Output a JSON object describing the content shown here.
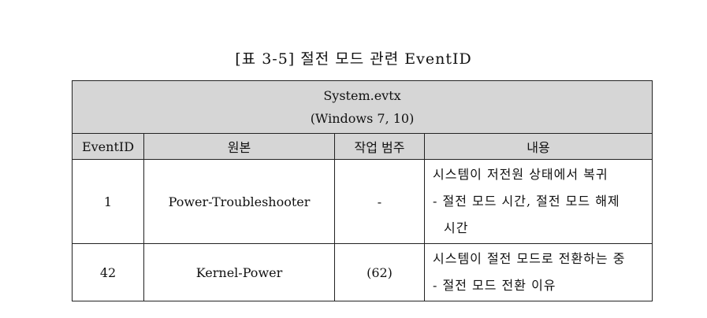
{
  "caption": "[표 3-5] 절전 모드 관련 EventID",
  "table": {
    "title_line1": "System.evtx",
    "title_line2": "(Windows 7, 10)",
    "columns": [
      "EventID",
      "원본",
      "작업 범주",
      "내용"
    ],
    "rows": [
      {
        "event_id": "1",
        "source": "Power-Troubleshooter",
        "category": "-",
        "desc_line1": "시스템이 저전원 상태에서 복귀",
        "desc_line2": "- 절전 모드 시간, 절전 모드 해제",
        "desc_line3": "시간"
      },
      {
        "event_id": "42",
        "source": "Kernel-Power",
        "category": "(62)",
        "desc_line1": "시스템이 절전 모드로 전환하는 중",
        "desc_line2": "- 절전 모드 전환 이유"
      }
    ]
  }
}
